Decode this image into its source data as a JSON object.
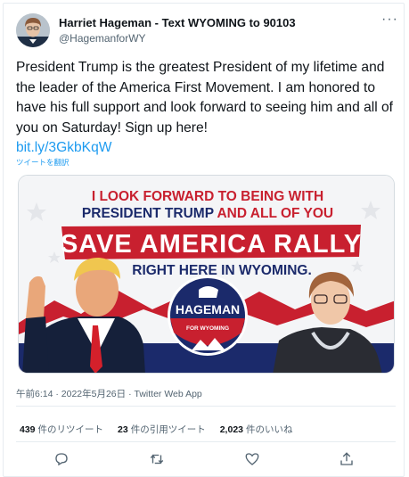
{
  "tweet": {
    "display_name": "Harriet Hageman - Text WYOMING to 90103",
    "handle": "@HagemanforWY",
    "more_icon": "more-dots-icon",
    "text": "President Trump is the greatest President of my lifetime and the leader of the America First Movement. I am honored to have his full support and look forward to seeing him and all of you on Saturday! Sign up here!",
    "link": "bit.ly/3GkbKqW",
    "translate_label": "ツイートを翻訳",
    "timestamp": "午前6:14 · 2022年5月26日",
    "client": "Twitter Web App"
  },
  "banner": {
    "line1": "I LOOK FORWARD TO BEING WITH",
    "line2a": "PRESIDENT TRUMP",
    "line2b": " AND ALL OF YOU",
    "headline": "SAVE AMERICA RALLY",
    "subline": "RIGHT HERE IN WYOMING.",
    "badge_name": "HAGEMAN",
    "badge_sub": "FOR WYOMING",
    "colors": {
      "red": "#c8202f",
      "navy": "#1b2a6b",
      "bg": "#f4f5f7"
    }
  },
  "stats": {
    "retweets_count": "439",
    "retweets_label": "件のリツイート",
    "quotes_count": "23",
    "quotes_label": "件の引用ツイート",
    "likes_count": "2,023",
    "likes_label": "件のいいね"
  },
  "actions": [
    "reply-icon",
    "retweet-icon",
    "like-icon",
    "share-icon"
  ]
}
